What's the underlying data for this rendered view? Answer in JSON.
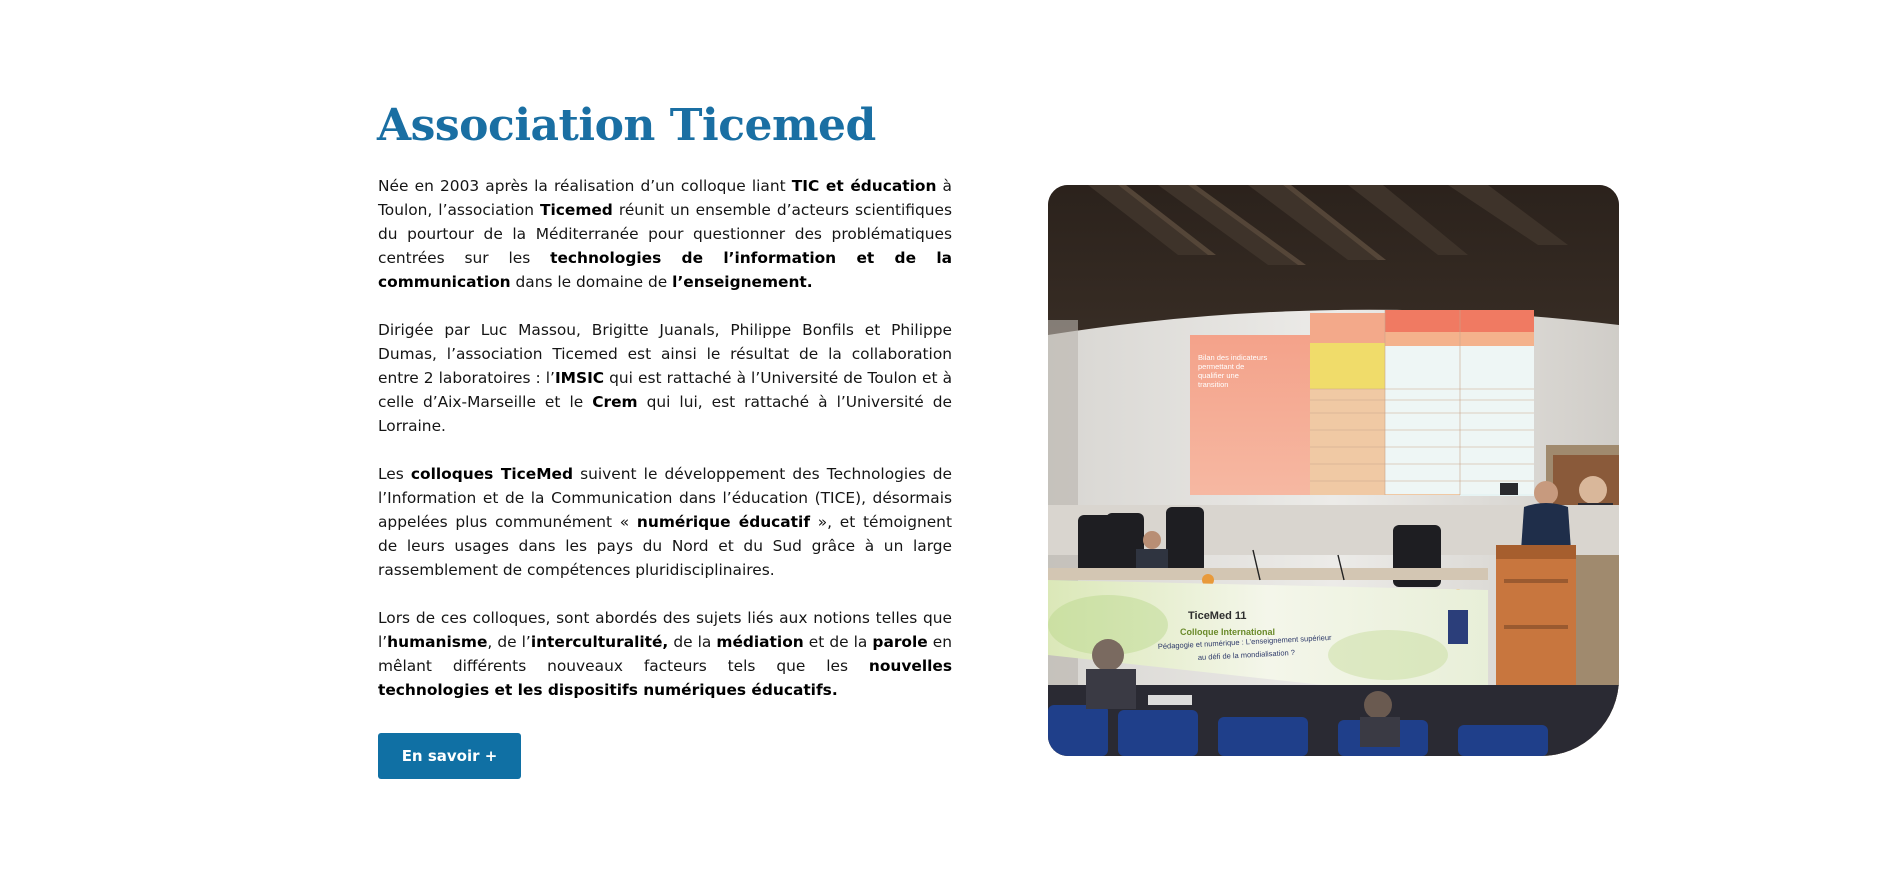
{
  "association": {
    "title": "Association Ticemed",
    "paragraphs": [
      [
        {
          "t": "Née en 2003 après la réalisation d’un colloque liant ",
          "b": false
        },
        {
          "t": "TIC et éducation",
          "b": true
        },
        {
          "t": " à Toulon, l’association ",
          "b": false
        },
        {
          "t": "Ticemed",
          "b": true
        },
        {
          "t": " réunit un ensemble d’acteurs scientifiques du pourtour de la Méditerranée pour questionner des problématiques centrées sur les ",
          "b": false
        },
        {
          "t": "technologies de l’information et de la communication",
          "b": true
        },
        {
          "t": " dans le domaine de ",
          "b": false
        },
        {
          "t": "l’enseignement.",
          "b": true
        }
      ],
      [
        {
          "t": "Dirigée par Luc Massou, Brigitte Juanals, Philippe Bonfils et Philippe Dumas, l’association Ticemed est ainsi le résultat de la collaboration entre 2 laboratoires : l’",
          "b": false
        },
        {
          "t": "IMSIC",
          "b": true
        },
        {
          "t": " qui est rattaché à l’Université de Toulon et à celle d’Aix-Marseille et le ",
          "b": false
        },
        {
          "t": "Crem",
          "b": true
        },
        {
          "t": " qui lui, est rattaché à l’Université de Lorraine.",
          "b": false
        }
      ],
      [
        {
          "t": "Les ",
          "b": false
        },
        {
          "t": "colloques TiceMed",
          "b": true
        },
        {
          "t": " suivent le développement des Technologies de l’Information et de la Communication dans l’éducation (TICE), désormais appelées plus communément « ",
          "b": false
        },
        {
          "t": "numérique éducatif",
          "b": true
        },
        {
          "t": " », et témoignent de leurs usages dans les pays du Nord et du Sud grâce à un large rassemblement de compétences pluridisciplinaires.",
          "b": false
        }
      ],
      [
        {
          "t": "Lors de ces colloques, sont abordés  des sujets liés aux notions telles que l’",
          "b": false
        },
        {
          "t": "humanisme",
          "b": true
        },
        {
          "t": ", de l’",
          "b": false
        },
        {
          "t": "interculturalité,",
          "b": true
        },
        {
          "t": " de la ",
          "b": false
        },
        {
          "t": "médiation",
          "b": true
        },
        {
          "t": " et de la ",
          "b": false
        },
        {
          "t": "parole",
          "b": true
        },
        {
          "t": " en mêlant différents nouveaux facteurs tels que les ",
          "b": false
        },
        {
          "t": "nouvelles technologies et les dispositifs numériques éducatifs.",
          "b": true
        }
      ]
    ],
    "cta_label": "En savoir +"
  },
  "photo": {
    "slide_title": "Bilan des indicateurs permettant de qualifier une transition",
    "banner_title": "TiceMed 11",
    "banner_subtitle": "Colloque International",
    "banner_theme": "Pédagogie et numérique : L’enseignement supérieur au défi de la mondialisation ?",
    "banner_logo": "crem"
  },
  "colors": {
    "accent": "#1a6fa3",
    "button": "#1070a4",
    "text": "#151515"
  }
}
